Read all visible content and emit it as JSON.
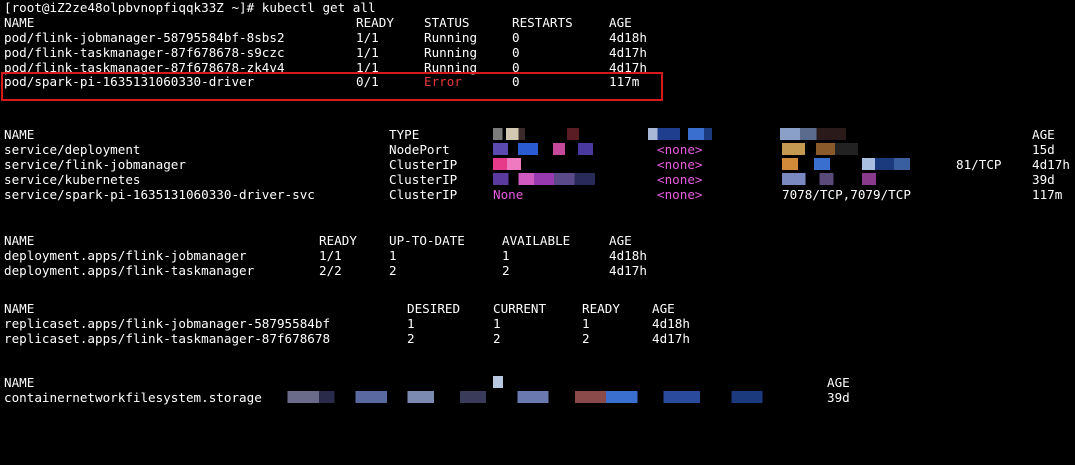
{
  "prompt": {
    "text": "[root@iZ2ze48olpbvnopfiqqk33Z ~]# kubectl get all"
  },
  "pods": {
    "headers": [
      "NAME",
      "READY",
      "STATUS",
      "RESTARTS",
      "AGE"
    ],
    "rows": [
      [
        "pod/flink-jobmanager-58795584bf-8sbs2",
        "1/1",
        "Running",
        "0",
        "4d18h"
      ],
      [
        "pod/flink-taskmanager-87f678678-s9czc",
        "1/1",
        "Running",
        "0",
        "4d17h"
      ],
      [
        "pod/flink-taskmanager-87f678678-zk4v4",
        "1/1",
        "Running",
        "0",
        "4d17h"
      ],
      [
        "pod/spark-pi-1635131060330-driver",
        "0/1",
        "Error",
        "0",
        "117m"
      ]
    ]
  },
  "services": {
    "headers": [
      "NAME",
      "TYPE",
      "AGE"
    ],
    "rows": [
      {
        "name": "service/deployment",
        "type": "NodePort",
        "external": "<none>",
        "ports": "",
        "age": "15d"
      },
      {
        "name": "service/flink-jobmanager",
        "type": "ClusterIP",
        "external": "<none>",
        "ports": "81/TCP",
        "age": "4d17h"
      },
      {
        "name": "service/kubernetes",
        "type": "ClusterIP",
        "external": "<none>",
        "ports": "",
        "age": "39d"
      },
      {
        "name": "service/spark-pi-1635131060330-driver-svc",
        "type": "ClusterIP",
        "cluster_ip": "None",
        "external": "<none>",
        "ports": "7078/TCP,7079/TCP",
        "age": "117m"
      }
    ]
  },
  "deployments": {
    "headers": [
      "NAME",
      "READY",
      "UP-TO-DATE",
      "AVAILABLE",
      "AGE"
    ],
    "rows": [
      [
        "deployment.apps/flink-jobmanager",
        "1/1",
        "1",
        "1",
        "4d18h"
      ],
      [
        "deployment.apps/flink-taskmanager",
        "2/2",
        "2",
        "2",
        "4d17h"
      ]
    ]
  },
  "replicasets": {
    "headers": [
      "NAME",
      "DESIRED",
      "CURRENT",
      "READY",
      "AGE"
    ],
    "rows": [
      [
        "replicaset.apps/flink-jobmanager-58795584bf",
        "1",
        "1",
        "1",
        "4d18h"
      ],
      [
        "replicaset.apps/flink-taskmanager-87f678678",
        "2",
        "2",
        "2",
        "4d17h"
      ]
    ]
  },
  "storage": {
    "headers": [
      "NAME",
      "AGE"
    ],
    "rows": [
      [
        "containernetworkfilesystem.storage",
        "39d"
      ]
    ]
  },
  "colors": {
    "error": "#e8373d",
    "highlight_box": "#d7191c",
    "none_text": "#e85ce0"
  }
}
